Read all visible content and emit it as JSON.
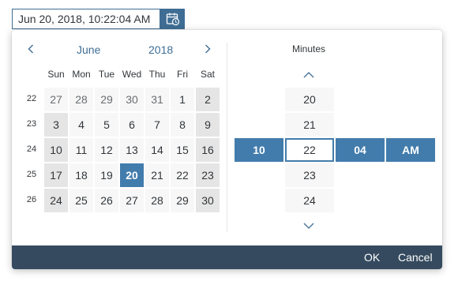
{
  "input": {
    "value": "Jun 20, 2018, 10:22:04 AM",
    "calendar_icon": "calendar-clock-icon"
  },
  "calendar": {
    "prev_icon": "chevron-left-icon",
    "next_icon": "chevron-right-icon",
    "month": "June",
    "year": "2018",
    "day_names": [
      "Sun",
      "Mon",
      "Tue",
      "Wed",
      "Thu",
      "Fri",
      "Sat"
    ],
    "week_numbers": [
      "22",
      "23",
      "24",
      "25",
      "26"
    ],
    "weeks": [
      [
        "27",
        "28",
        "29",
        "30",
        "31",
        "1",
        "2"
      ],
      [
        "3",
        "4",
        "5",
        "6",
        "7",
        "8",
        "9"
      ],
      [
        "10",
        "11",
        "12",
        "13",
        "14",
        "15",
        "16"
      ],
      [
        "17",
        "18",
        "19",
        "20",
        "21",
        "22",
        "23"
      ],
      [
        "24",
        "25",
        "26",
        "27",
        "28",
        "29",
        "30"
      ]
    ],
    "selected_day": "20"
  },
  "time": {
    "title": "Minutes",
    "up_icon": "chevron-up-icon",
    "down_icon": "chevron-down-icon",
    "minutes": [
      "20",
      "21",
      "22",
      "23",
      "24"
    ],
    "hour": "10",
    "minute": "22",
    "second": "04",
    "ampm": "AM"
  },
  "footer": {
    "ok": "OK",
    "cancel": "Cancel"
  },
  "colors": {
    "accent": "#427cac",
    "footer": "#354a5f",
    "weekend": "#e5e5e5",
    "cell": "#f7f7f7"
  }
}
